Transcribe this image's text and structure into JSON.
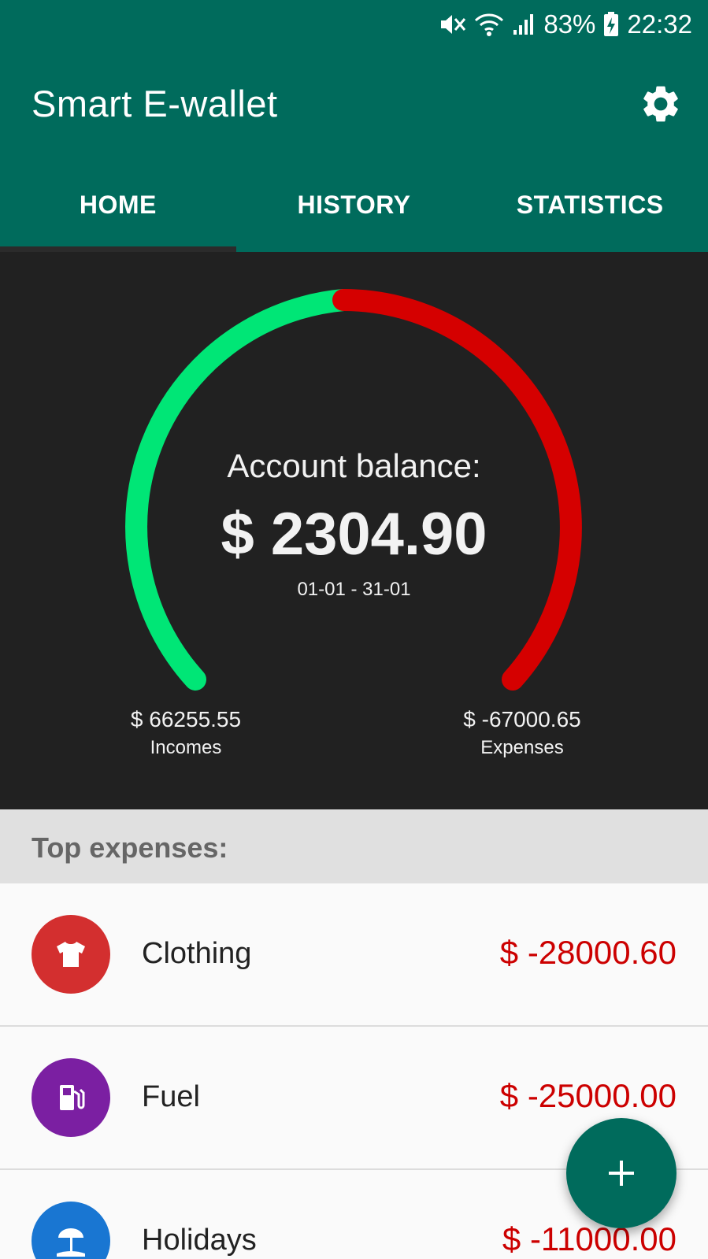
{
  "status_bar": {
    "battery": "83%",
    "time": "22:32"
  },
  "app": {
    "title": "Smart E-wallet"
  },
  "tabs": [
    {
      "label": "HOME",
      "active": true
    },
    {
      "label": "HISTORY",
      "active": false
    },
    {
      "label": "STATISTICS",
      "active": false
    }
  ],
  "summary": {
    "balance_label": "Account balance:",
    "balance_value": "$ 2304.90",
    "date_range": "01-01 - 31-01",
    "incomes_value": "$ 66255.55",
    "incomes_label": "Incomes",
    "expenses_value": "$ -67000.65",
    "expenses_label": "Expenses",
    "income_color": "#00e676",
    "expense_color": "#d50000"
  },
  "top_expenses": {
    "heading": "Top expenses:",
    "items": [
      {
        "name": "Clothing",
        "amount": "$ -28000.60",
        "color": "#d32f2f",
        "icon": "tshirt-icon"
      },
      {
        "name": "Fuel",
        "amount": "$ -25000.00",
        "color": "#7b1fa2",
        "icon": "fuel-pump-icon"
      },
      {
        "name": "Holidays",
        "amount": "$ -11000.00",
        "color": "#1976d2",
        "icon": "beach-umbrella-icon"
      }
    ]
  },
  "fab": {
    "icon": "plus-icon"
  }
}
